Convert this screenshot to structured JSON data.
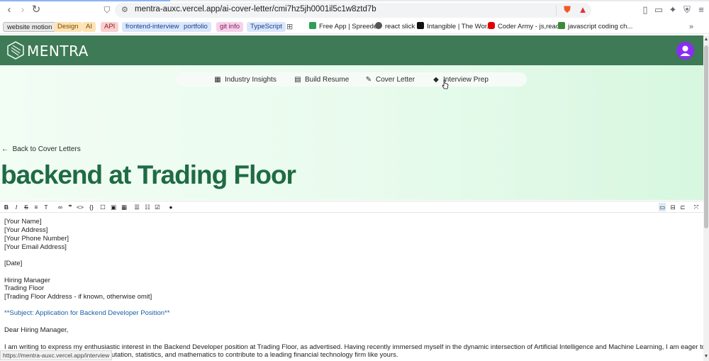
{
  "browser": {
    "url": "mentra-auxc.vercel.app/ai-cover-letter/cmi7hz5jh0001il5c1w8ztd7b",
    "status_url": "https://mentra-auxc.vercel.app/interview"
  },
  "bookmarks": {
    "chips": [
      {
        "label": "website motion",
        "bg": "#e8e8e8",
        "fg": "#222222"
      },
      {
        "label": "Design",
        "bg": "#fde3b5",
        "fg": "#7a4a00"
      },
      {
        "label": "AI",
        "bg": "#fde3b5",
        "fg": "#7a4a00"
      },
      {
        "label": "API",
        "bg": "#f9d0d0",
        "fg": "#8a1b1b"
      },
      {
        "label": "frontend-interview",
        "bg": "#d9e6fb",
        "fg": "#1b3f8a"
      },
      {
        "label": "portfolio",
        "bg": "#d9e6fb",
        "fg": "#1b3f8a"
      },
      {
        "label": "git info",
        "bg": "#f6d1e9",
        "fg": "#7a1b5c"
      },
      {
        "label": "TypeScript",
        "bg": "#d9e6fb",
        "fg": "#1b3f8a"
      }
    ],
    "links": [
      {
        "label": "Free App | Spreeder",
        "icon": "spreeder-icon",
        "color": "#2e9e5b"
      },
      {
        "label": "react slick",
        "icon": "globe-icon",
        "color": "#555555"
      },
      {
        "label": "Intangible | The Wor...",
        "icon": "x-icon",
        "color": "#111111"
      },
      {
        "label": "Coder Army - js,react",
        "icon": "youtube-icon",
        "color": "#e00000"
      },
      {
        "label": "javascript coding ch...",
        "icon": "check-icon",
        "color": "#3a8a3a"
      }
    ]
  },
  "app": {
    "brand": "MENTRA",
    "header_color": "#3d7a55",
    "nav": [
      {
        "label": "Industry Insights",
        "icon": "grid-icon"
      },
      {
        "label": "Build Resume",
        "icon": "document-icon"
      },
      {
        "label": "Cover Letter",
        "icon": "edit-icon"
      },
      {
        "label": "Interview Prep",
        "icon": "graduation-cap-icon"
      }
    ],
    "back_label": "Back to Cover Letters",
    "title": "backend at Trading Floor"
  },
  "editor": {
    "lines": [
      "[Your Name]",
      "[Your Address]",
      "[Your Phone Number]",
      "[Your Email Address]",
      "[Date]",
      "Hiring Manager",
      "Trading Floor",
      "[Trading Floor Address - if known, otherwise omit]",
      "**Subject: Application for Backend Developer Position**",
      "Dear Hiring Manager,",
      "I am writing to express my enthusiastic interest in the Backend Developer position at Trading Floor, as advertised. Having recently immersed myself in the dynamic intersection of Artificial Intelligence and Machine Learning, I am eager to apply",
      "my foundational knowledge in computation, statistics, and mathematics to contribute to a leading financial technology firm like yours."
    ]
  }
}
